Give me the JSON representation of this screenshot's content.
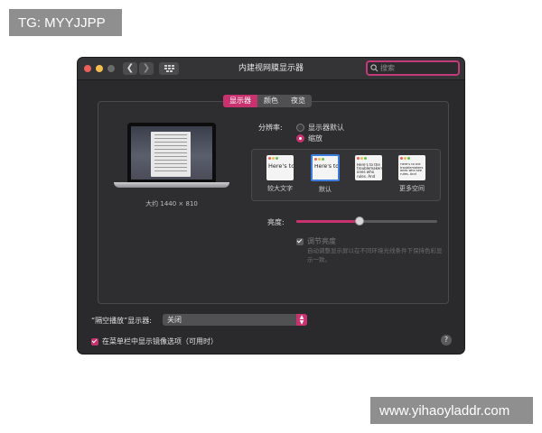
{
  "watermarks": {
    "top_left": "TG: MYYJJPP",
    "bottom_right": "www.yihaoyladdr.com"
  },
  "window": {
    "title": "内建视网膜显示器",
    "search_placeholder": "搜索"
  },
  "tabs": [
    {
      "label": "显示器",
      "active": true
    },
    {
      "label": "颜色",
      "active": false
    },
    {
      "label": "夜览",
      "active": false
    }
  ],
  "display": {
    "resolution_text": "大约 1440 × 810"
  },
  "resolution": {
    "label": "分辨率:",
    "option_default": "显示器默认",
    "option_scaled": "缩放",
    "selected": "缩放"
  },
  "scaling_options": [
    {
      "caption": "较大文字",
      "sample": "Here's to troublem",
      "selected": false
    },
    {
      "caption": "默认",
      "sample": "Here's to troublem",
      "selected": true
    },
    {
      "caption": "",
      "sample": "Here's to the troublemakers ones who rules. And",
      "selected": false
    },
    {
      "caption": "更多空间",
      "sample": "Here's to the troublemakers ones who see rules. And",
      "selected": false
    }
  ],
  "brightness": {
    "label": "亮度:",
    "level": 0.45
  },
  "auto_brightness": {
    "label": "调节亮度",
    "description": "自动调整显示屏以在不同环境光线条件下保持色彩显示一致。",
    "checked": true,
    "enabled": false
  },
  "airplay": {
    "label": "“隔空播放”显示器:",
    "value": "关闭"
  },
  "mirror_option": {
    "label": "在菜单栏中显示镜像选项（可用时）",
    "checked": true
  },
  "help": {
    "label": "?"
  },
  "colors": {
    "accent": "#c8336f",
    "window_bg": "#2a2a2c",
    "selection_blue": "#3b7ee0"
  }
}
